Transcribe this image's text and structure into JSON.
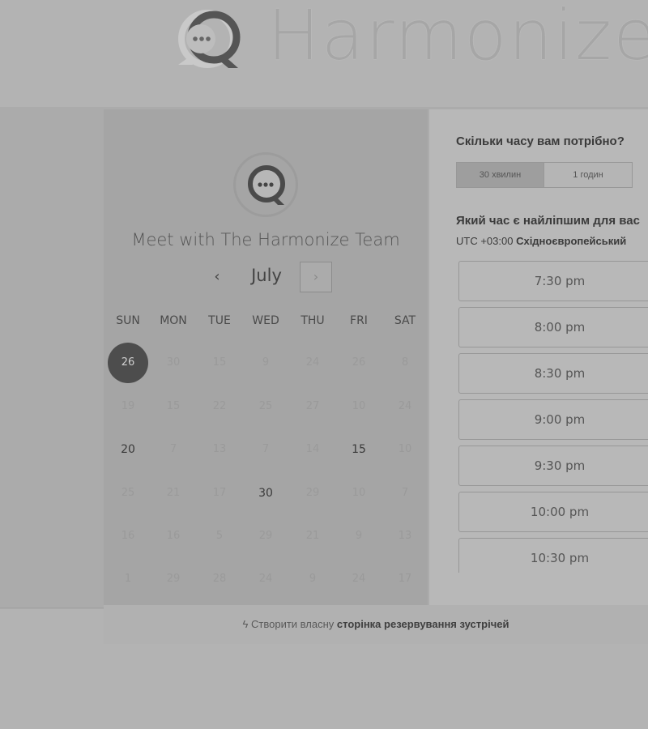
{
  "brand": {
    "name": "Harmonize",
    "logo_icon": "chat-bubble-logo-icon"
  },
  "calendar": {
    "title": "Meet with The Harmonize Team",
    "month": "July",
    "prev_icon": "‹",
    "next_icon": "›",
    "weekdays": [
      "SUN",
      "MON",
      "TUE",
      "WED",
      "THU",
      "FRI",
      "SAT"
    ],
    "weeks": [
      [
        "26",
        "30",
        "15",
        "9",
        "24",
        "26",
        "8"
      ],
      [
        "19",
        "15",
        "22",
        "25",
        "27",
        "10",
        "24"
      ],
      [
        "20",
        "7",
        "13",
        "7",
        "14",
        "15",
        "10"
      ],
      [
        "25",
        "21",
        "17",
        "30",
        "29",
        "10",
        "7"
      ],
      [
        "16",
        "16",
        "5",
        "29",
        "21",
        "9",
        "13"
      ],
      [
        "1",
        "29",
        "28",
        "24",
        "9",
        "24",
        "17"
      ]
    ],
    "selected_day": "26",
    "available_days": [
      "20",
      "15",
      "30"
    ]
  },
  "duration": {
    "question": "Скільки часу вам потрібно?",
    "options": [
      {
        "label": "30 хвилин",
        "selected": true
      },
      {
        "label": "1 годин",
        "selected": false
      }
    ]
  },
  "times": {
    "question": "Який час є найліпшим для вас",
    "timezone_offset": "UTC +03:00",
    "timezone_name": "Східноєвропейський",
    "slots": [
      "7:30 pm",
      "8:00 pm",
      "8:30 pm",
      "9:00 pm",
      "9:30 pm",
      "10:00 pm",
      "10:30 pm"
    ]
  },
  "footer": {
    "icon": "hubspot-sprocket-icon",
    "text_prefix": "Створити власну",
    "text_bold": "сторінка резервування зустрічей"
  },
  "colors": {
    "selected_day_bg": "#4d4d4d",
    "panel_bg": "#a5a5a5",
    "page_bg": "#b3b3b3"
  }
}
